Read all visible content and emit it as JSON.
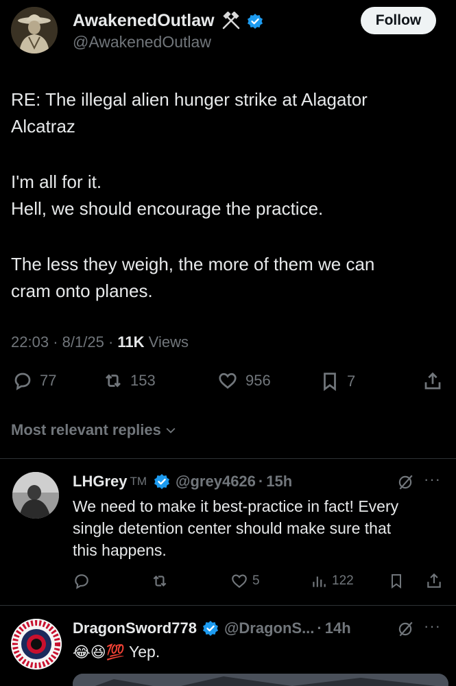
{
  "post": {
    "author_name": "AwakenedOutlaw",
    "author_handle": "@AwakenedOutlaw",
    "follow_label": "Follow",
    "text_lines": [
      "RE: The illegal alien hunger strike at Alagator",
      "Alcatraz",
      "I'm all for it.",
      "Hell, we should encourage the practice.",
      "The less they weigh, the more of them we can",
      "cram onto planes."
    ],
    "time": "22:03",
    "date": "8/1/25",
    "views_count": "11K",
    "views_label": "Views",
    "replies": "77",
    "reposts": "153",
    "likes": "956",
    "bookmarks": "7"
  },
  "replies_section": {
    "label": "Most relevant replies"
  },
  "replies": [
    {
      "name": "LHGrey",
      "tm": "TM",
      "handle": "@grey4626",
      "time": "15h",
      "text_lines": [
        "We need to make it best-practice in fact!  Every",
        "single detention center should make sure that",
        "this happens."
      ],
      "likes": "5",
      "views": "122"
    },
    {
      "name": "DragonSword778",
      "handle": "@DragonS...",
      "time": "14h",
      "text": "Yep.",
      "emoji": "😂😆💯"
    }
  ],
  "colors": {
    "background": "#000000",
    "text": "#e7e9ea",
    "muted": "#71767b",
    "verified": "#1d9bf0",
    "follow_bg": "#eff3f4"
  }
}
